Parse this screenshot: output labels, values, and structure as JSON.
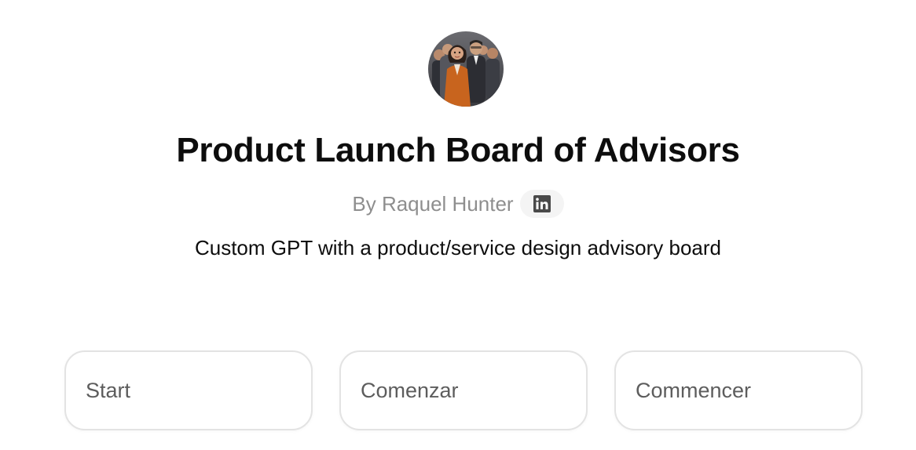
{
  "gpt": {
    "avatar_icon": "advisory-board-avatar",
    "title": "Product Launch Board of Advisors",
    "author": "By Raquel Hunter",
    "social_icon": "linkedin-icon",
    "description": "Custom GPT with a product/service design advisory board"
  },
  "conversation_starters": [
    {
      "label": "Start"
    },
    {
      "label": "Comenzar"
    },
    {
      "label": "Commencer"
    }
  ],
  "colors": {
    "title": "#0d0d0d",
    "author": "#8e8e8e",
    "starter_border": "#e3e3e3",
    "starter_text": "#5d5d5d",
    "chip_bg": "#f4f4f4"
  }
}
